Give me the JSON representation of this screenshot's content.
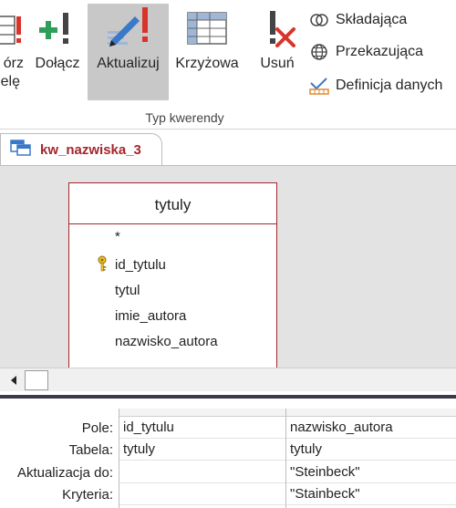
{
  "ribbon": {
    "buttons": [
      {
        "id": "make-table",
        "label_line1": "órz",
        "label_line2": "elę"
      },
      {
        "id": "append",
        "label": "Dołącz"
      },
      {
        "id": "update",
        "label": "Aktualizuj",
        "active": true
      },
      {
        "id": "crosstab",
        "label": "Krzyżowa"
      },
      {
        "id": "delete",
        "label": "Usuń"
      }
    ],
    "small_buttons": [
      {
        "id": "union",
        "label": "Składająca",
        "icon": "union-icon"
      },
      {
        "id": "passthrough",
        "label": "Przekazująca",
        "icon": "globe-icon"
      },
      {
        "id": "data-definition",
        "label": "Definicja danych",
        "icon": "data-definition-icon"
      }
    ],
    "group_label": "Typ kwerendy"
  },
  "document_tab": {
    "label": "kw_nazwiska_3",
    "icon": "query-icon"
  },
  "table_box": {
    "title": "tytuly",
    "fields": [
      "*",
      "id_tytulu",
      "tytul",
      "imie_autora",
      "nazwisko_autora"
    ],
    "primary_key_field": "id_tytulu"
  },
  "qbe": {
    "row_labels": [
      "Pole:",
      "Tabela:",
      "Aktualizacja do:",
      "Kryteria:"
    ],
    "columns": [
      {
        "field": "id_tytulu",
        "table": "tytuly",
        "update_to": "",
        "criteria": ""
      },
      {
        "field": "nazwisko_autora",
        "table": "tytuly",
        "update_to": "\"Steinbeck\"",
        "criteria": "\"Stainbeck\""
      }
    ]
  },
  "colors": {
    "accent": "#a4262c",
    "surface": "#e3e3e3",
    "active_button": "#c8c8c8",
    "splitter": "#3a3a4a"
  }
}
